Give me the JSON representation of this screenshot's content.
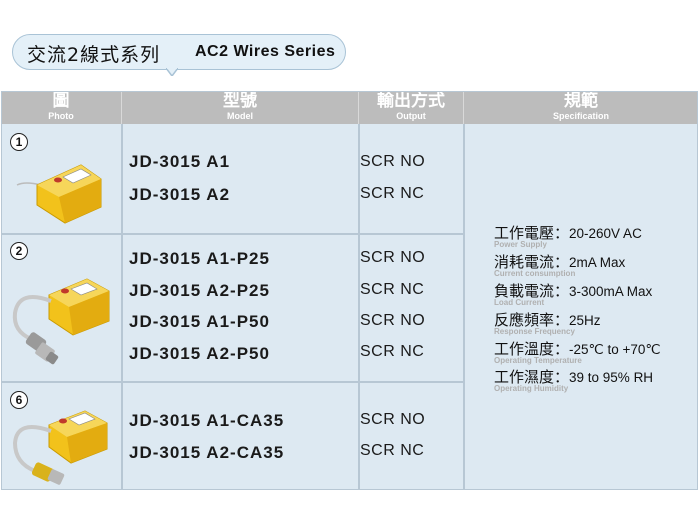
{
  "title": {
    "zh": "交流2線式系列",
    "en": "AC2 Wires Series"
  },
  "header": {
    "photo_zh": "圖",
    "photo_en": "Photo",
    "model_zh": "型號",
    "model_en": "Model",
    "output_zh": "輸出方式",
    "output_en": "Output",
    "spec_zh": "規範",
    "spec_en": "Specification"
  },
  "groups": [
    {
      "num": "1",
      "models": [
        "JD-3015 A1",
        "JD-3015 A2"
      ],
      "outputs": [
        "SCR NO",
        "SCR NC"
      ]
    },
    {
      "num": "2",
      "models": [
        "JD-3015 A1-P25",
        "JD-3015 A2-P25",
        "JD-3015 A1-P50",
        "JD-3015 A2-P50"
      ],
      "outputs": [
        "SCR NO",
        "SCR NC",
        "SCR NO",
        "SCR NC"
      ]
    },
    {
      "num": "6",
      "models": [
        "JD-3015 A1-CA35",
        "JD-3015 A2-CA35"
      ],
      "outputs": [
        "SCR NO",
        "SCR NC"
      ]
    }
  ],
  "specs": [
    {
      "zh": "工作電壓：",
      "val": "20-260V AC",
      "en": "Power Supply"
    },
    {
      "zh": "消耗電流：",
      "val": "2mA Max",
      "en": "Current consumption"
    },
    {
      "zh": "負載電流：",
      "val": "3-300mA Max",
      "en": "Load Current"
    },
    {
      "zh": "反應頻率：",
      "val": "25Hz",
      "en": "Response Frequency"
    },
    {
      "zh": "工作溫度：",
      "val": "-25℃ to +70℃",
      "en": "Operating Temperature"
    },
    {
      "zh": "工作濕度：",
      "val": "39 to 95% RH",
      "en": "Operating Humidity"
    }
  ],
  "colors": {
    "header_bg": "#bcbcbc",
    "body_bg": "#dde9f2",
    "sensor_yellow": "#f2c21b"
  }
}
